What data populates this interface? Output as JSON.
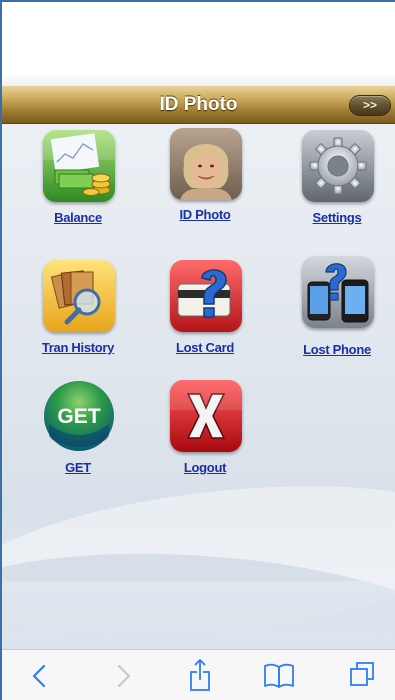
{
  "header": {
    "title": "ID Photo",
    "next_label": ">>"
  },
  "tiles": [
    {
      "label": "Balance",
      "icon": "balance-icon"
    },
    {
      "label": "ID Photo",
      "icon": "id-photo-icon"
    },
    {
      "label": "Settings",
      "icon": "gear-icon"
    },
    {
      "label": "Tran History",
      "icon": "tran-history-icon"
    },
    {
      "label": "Lost Card",
      "icon": "lost-card-icon"
    },
    {
      "label": "Lost Phone",
      "icon": "lost-phone-icon"
    },
    {
      "label": "GET",
      "icon": "get-logo-icon",
      "badge_text": "GET"
    },
    {
      "label": "Logout",
      "icon": "logout-x-icon"
    }
  ],
  "toolbar": {
    "icons": [
      "back-chevron-icon",
      "forward-chevron-icon",
      "share-icon",
      "bookmarks-icon",
      "tabs-icon"
    ]
  },
  "colors": {
    "title_bar": "#a9863d",
    "link": "#1a2fa8",
    "ios_blue": "#2f7df6"
  }
}
